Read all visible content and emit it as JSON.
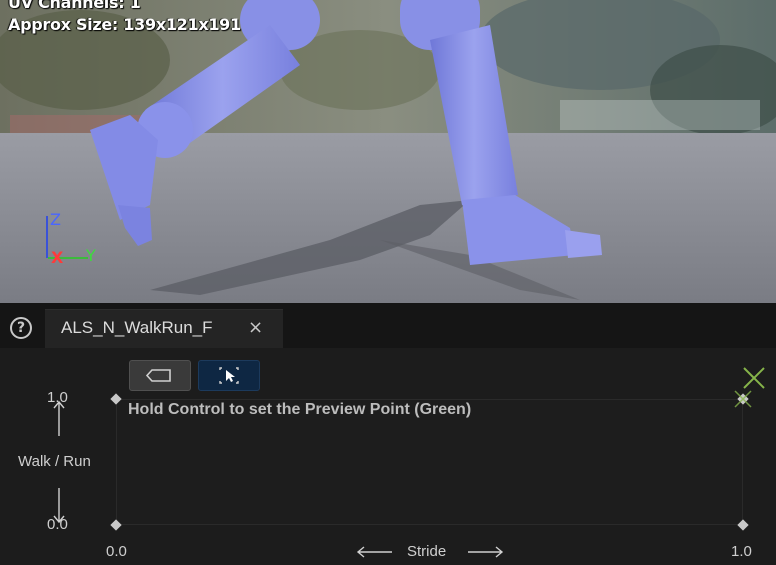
{
  "viewport": {
    "uv_channels": "UV Channels: 1",
    "approx_size": "Approx Size: 139x121x191",
    "axis": {
      "z": "Z",
      "x": "X",
      "y": "Y"
    }
  },
  "tabs": [
    {
      "label": "ALS_N_WalkRun_F",
      "close": "×",
      "active": true
    }
  ],
  "help_glyph": "?",
  "editor": {
    "hint": "Hold Control to set the Preview Point (Green)",
    "y_axis": {
      "label": "Walk / Run",
      "max": "1.0",
      "min": "0.0"
    },
    "x_axis": {
      "label": "Stride",
      "min": "0.0",
      "max": "1.0"
    },
    "toolbar": {
      "fit_icon": "tag-icon",
      "select_icon": "cursor-select-icon"
    },
    "colors": {
      "preview_point": "#86b44a",
      "select_bg": "#0e2743"
    }
  }
}
